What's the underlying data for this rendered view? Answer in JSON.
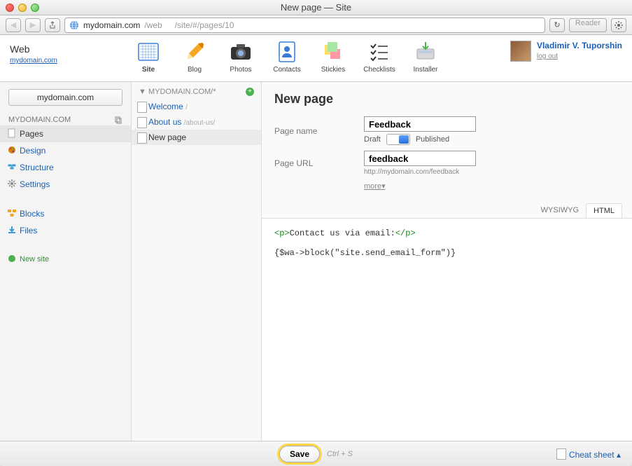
{
  "window": {
    "title": "New page — Site"
  },
  "browser": {
    "url_host": "mydomain.com",
    "url_path1": "/web",
    "url_path2": "/site/#/pages/10",
    "reader_label": "Reader"
  },
  "brand": {
    "name": "Web",
    "link": "mydomain.com"
  },
  "apps": [
    {
      "label": "Site",
      "key": "site",
      "active": true
    },
    {
      "label": "Blog",
      "key": "blog"
    },
    {
      "label": "Photos",
      "key": "photos"
    },
    {
      "label": "Contacts",
      "key": "contacts"
    },
    {
      "label": "Stickies",
      "key": "stickies"
    },
    {
      "label": "Checklists",
      "key": "checklists"
    },
    {
      "label": "Installer",
      "key": "installer"
    }
  ],
  "user": {
    "name": "Vladimir V. Tuporshin",
    "logout": "log out"
  },
  "leftnav": {
    "domain_button": "mydomain.com",
    "section": "MYDOMAIN.COM",
    "items": [
      {
        "label": "Pages",
        "key": "pages",
        "active": true
      },
      {
        "label": "Design",
        "key": "design"
      },
      {
        "label": "Structure",
        "key": "structure"
      },
      {
        "label": "Settings",
        "key": "settings"
      }
    ],
    "items2": [
      {
        "label": "Blocks",
        "key": "blocks"
      },
      {
        "label": "Files",
        "key": "files"
      }
    ],
    "new_site": "New site"
  },
  "pagelist": {
    "header": "MYDOMAIN.COM/*",
    "items": [
      {
        "label": "Welcome",
        "slug": "/"
      },
      {
        "label": "About us",
        "slug": "/about-us/"
      },
      {
        "label": "New page",
        "slug": "",
        "selected": true
      }
    ]
  },
  "editor": {
    "title": "New page",
    "fields": {
      "name_label": "Page name",
      "name_value": "Feedback",
      "status_draft": "Draft",
      "status_published": "Published",
      "url_label": "Page URL",
      "url_value": "feedback",
      "url_hint": "http://mydomain.com/feedback",
      "more": "more"
    },
    "tabs": {
      "wysiwyg": "WYSIWYG",
      "html": "HTML",
      "active": "html"
    },
    "code_line1_open": "<p>",
    "code_line1_text": "Contact us via email:",
    "code_line1_close": "</p>",
    "code_line2": "{$wa->block(\"site.send_email_form\")}"
  },
  "footer": {
    "save": "Save",
    "save_hint": "Ctrl + S",
    "cheat": "Cheat sheet"
  }
}
